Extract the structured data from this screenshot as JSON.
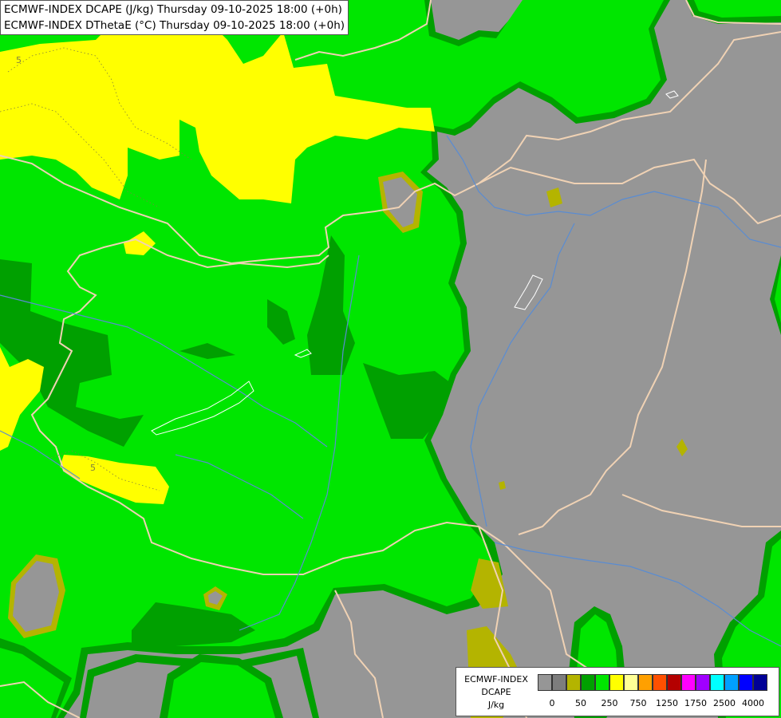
{
  "header": {
    "line1": "ECMWF-INDEX DCAPE (J/kg) Thursday 09-10-2025 18:00 (+0h)",
    "line2": "ECMWF-INDEX DThetaE (°C) Thursday 09-10-2025 18:00 (+0h)"
  },
  "map_labels": {
    "contour_label_nw": "5",
    "contour_label_sw": "5"
  },
  "colors": {
    "gray": "#969696",
    "olive": "#b4b400",
    "darkgreen": "#00a000",
    "green": "#00e600",
    "yellow": "#ffff00",
    "border_line": "#f0d2b4",
    "river": "#5a8cd2"
  },
  "legend": {
    "model": "ECMWF-INDEX",
    "parameter": "DCAPE",
    "unit": "J/kg",
    "swatch_colors": [
      "#969696",
      "#7d7d7d",
      "#b4b400",
      "#00a000",
      "#00e600",
      "#ffff00",
      "#ffff96",
      "#ffa000",
      "#ff5000",
      "#b40000",
      "#ff00ff",
      "#a000ff",
      "#00ffff",
      "#00a0ff",
      "#0000ff",
      "#000096"
    ],
    "tick_labels": [
      "0",
      "50",
      "250",
      "750",
      "1250",
      "1750",
      "2500",
      "4000"
    ]
  }
}
